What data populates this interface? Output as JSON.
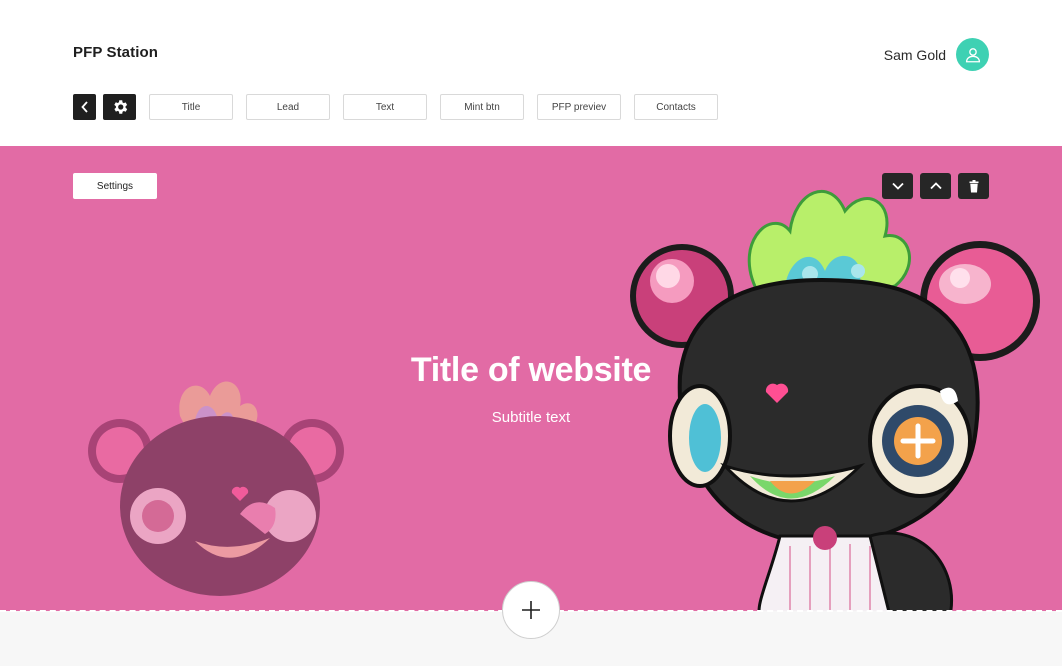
{
  "app": {
    "brand": "PFP Station"
  },
  "user": {
    "name": "Sam Gold",
    "avatar_icon": "user-icon",
    "avatar_color": "#3ed1b3"
  },
  "toolbar": {
    "back_icon": "chevron-left-icon",
    "settings_icon": "gear-icon",
    "sections": [
      "Title",
      "Lead",
      "Text",
      "Mint btn",
      "PFP previev",
      "Contacts"
    ]
  },
  "hero": {
    "background_color": "#e26ba5",
    "settings_label": "Settings",
    "controls": [
      "chevron-down-icon",
      "chevron-up-icon",
      "trash-icon"
    ],
    "title": "Title of website",
    "subtitle": "Subtitle text"
  },
  "add_block": {
    "icon": "plus-icon"
  }
}
